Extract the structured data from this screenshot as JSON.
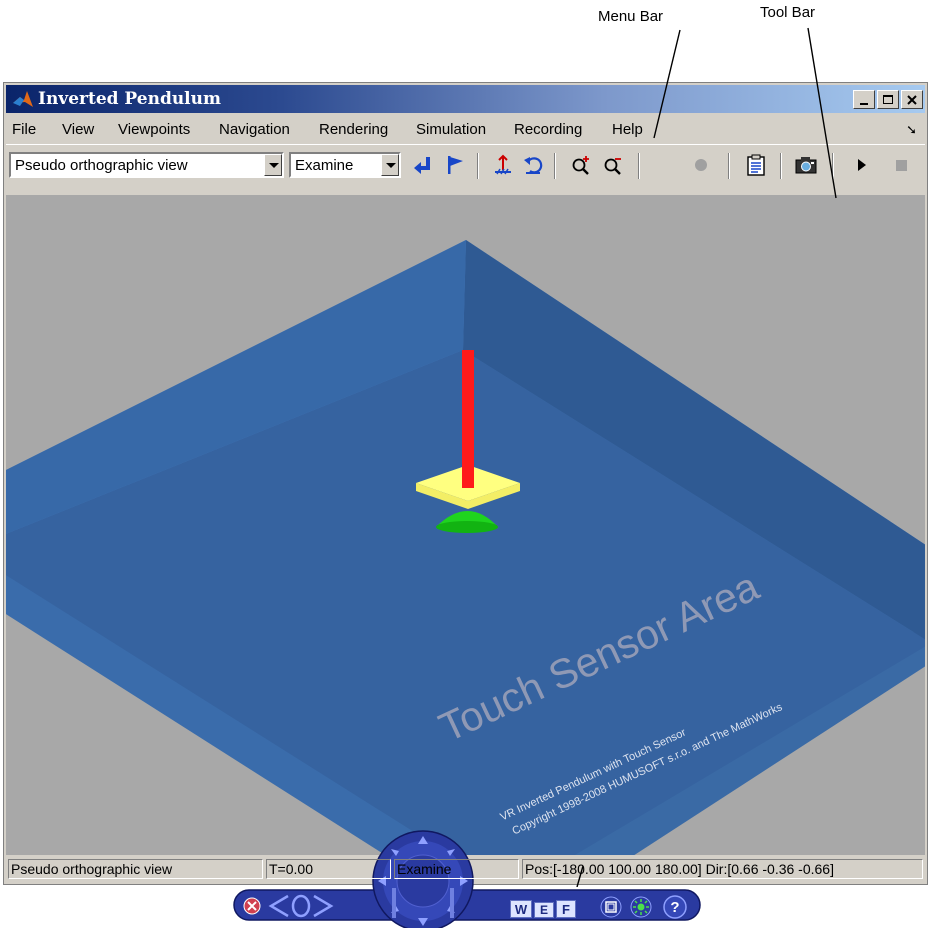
{
  "annotations": {
    "menu_bar": "Menu Bar",
    "tool_bar": "Tool Bar"
  },
  "window": {
    "title": "Inverted Pendulum",
    "controls": [
      "minimize-icon",
      "maximize-icon",
      "close-icon"
    ]
  },
  "menu": {
    "items": [
      "File",
      "View",
      "Viewpoints",
      "Navigation",
      "Rendering",
      "Simulation",
      "Recording",
      "Help"
    ]
  },
  "toolbar": {
    "viewpoint_select": "Pseudo orthographic view",
    "navigation_select": "Examine",
    "buttons": [
      "return-icon",
      "flag-icon",
      "straighten-icon",
      "undo-move-icon",
      "zoom-in-icon",
      "zoom-out-icon",
      "record-icon",
      "clipboard-icon",
      "camera-icon",
      "play-icon",
      "stop-icon"
    ]
  },
  "scene": {
    "sensor_label": "Touch Sensor Area",
    "line1": "VR Inverted Pendulum with Touch Sensor",
    "line2": "Copyright 1998-2008 HUMUSOFT s.r.o. and The MathWorks",
    "colors": {
      "platform": "#4a7fc0",
      "floor": "#3663a0",
      "pendulum": "#ff1a1a",
      "base": "#ffff80",
      "cone": "#22dd22",
      "background": "#a8a8a8"
    }
  },
  "navpanel": {
    "buttons": [
      "W",
      "E",
      "F"
    ],
    "icons": [
      "close-icon",
      "left-arrow-icon",
      "turn-icon",
      "right-arrow-icon",
      "navigation-wheel-icon",
      "straighten-icon",
      "headlight-icon",
      "help-icon"
    ]
  },
  "status": {
    "viewpoint": "Pseudo orthographic view",
    "time": "T=0.00",
    "mode": "Examine",
    "position": "Pos:[-180.00 100.00 180.00] Dir:[0.66 -0.36 -0.66]"
  }
}
